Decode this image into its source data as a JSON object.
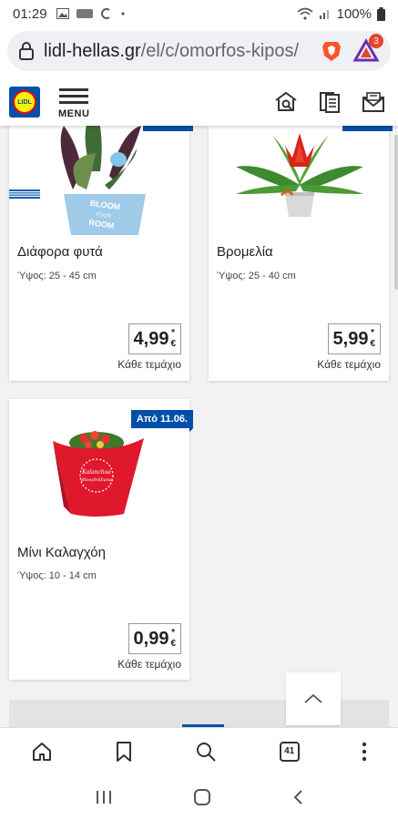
{
  "status_bar": {
    "time": "01:29",
    "battery": "100%"
  },
  "browser": {
    "url_domain": "lidl-hellas.gr",
    "url_path": "/el/c/omorfos-kipos/",
    "rewards_count": "3",
    "tab_count": "41"
  },
  "site_header": {
    "menu_label": "MENU"
  },
  "products": [
    {
      "name": "Διάφορα φυτά",
      "height": "Ύψος: 25 - 45 cm",
      "price": "4,99",
      "price_star": "*",
      "currency": "€",
      "per_piece": "Κάθε τεμάχιο"
    },
    {
      "name": "Βρομελία",
      "height": "Ύψος: 25 - 40 cm",
      "price": "5,99",
      "price_star": "*",
      "currency": "€",
      "per_piece": "Κάθε τεμάχιο"
    },
    {
      "name": "Μίνι Καλαγχόη",
      "height": "Ύψος: 10 - 14 cm",
      "price": "0,99",
      "price_star": "*",
      "currency": "€",
      "per_piece": "Κάθε τεμάχιο",
      "ribbon": "Από 11.06."
    }
  ],
  "pot_texts": {
    "bloom_1": "BLOOM",
    "bloom_2": "YOUR",
    "bloom_3": "ROOM",
    "kalanchoe_1": "Kalanchoe",
    "kalanchoe_2": "Blossfeldiana"
  },
  "colors": {
    "lidl_blue": "#0050aa",
    "lidl_yellow": "#fff000",
    "lidl_red": "#e60a14"
  }
}
